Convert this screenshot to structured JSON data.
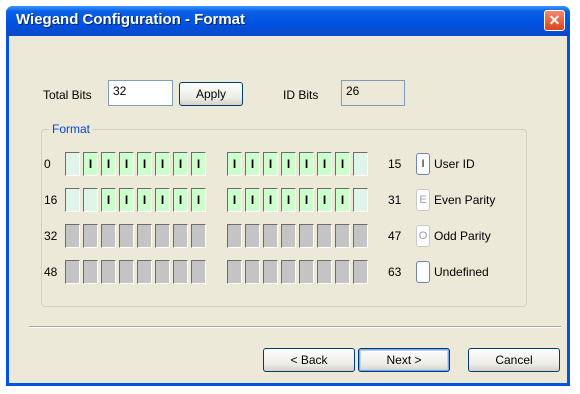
{
  "window": {
    "title": "Wiegand Configuration - Format",
    "close_glyph": "✕"
  },
  "total_bits": {
    "label": "Total Bits",
    "value": "32"
  },
  "apply_label": "Apply",
  "id_bits": {
    "label": "ID Bits",
    "value": "26"
  },
  "format": {
    "legend": "Format",
    "rows": [
      {
        "start": "0",
        "end": "15",
        "bits": [
          "N",
          "U",
          "U",
          "U",
          "U",
          "U",
          "U",
          "U",
          "U",
          "U",
          "U",
          "U",
          "U",
          "U",
          "U",
          "N"
        ],
        "marks": [
          "",
          "I",
          "I",
          "I",
          "I",
          "I",
          "I",
          "I",
          "I",
          "I",
          "I",
          "I",
          "I",
          "I",
          "I",
          ""
        ]
      },
      {
        "start": "16",
        "end": "31",
        "bits": [
          "N",
          "N",
          "U",
          "U",
          "U",
          "U",
          "U",
          "U",
          "U",
          "U",
          "U",
          "U",
          "U",
          "U",
          "U",
          "N"
        ],
        "marks": [
          "",
          "",
          "I",
          "I",
          "I",
          "I",
          "I",
          "I",
          "I",
          "I",
          "I",
          "I",
          "I",
          "I",
          "I",
          ""
        ]
      },
      {
        "start": "32",
        "end": "47",
        "bits": [
          "X",
          "X",
          "X",
          "X",
          "X",
          "X",
          "X",
          "X",
          "X",
          "X",
          "X",
          "X",
          "X",
          "X",
          "X",
          "X"
        ],
        "marks": [
          "",
          "",
          "",
          "",
          "",
          "",
          "",
          "",
          "",
          "",
          "",
          "",
          "",
          "",
          "",
          ""
        ]
      },
      {
        "start": "48",
        "end": "63",
        "bits": [
          "X",
          "X",
          "X",
          "X",
          "X",
          "X",
          "X",
          "X",
          "X",
          "X",
          "X",
          "X",
          "X",
          "X",
          "X",
          "X"
        ],
        "marks": [
          "",
          "",
          "",
          "",
          "",
          "",
          "",
          "",
          "",
          "",
          "",
          "",
          "",
          "",
          "",
          ""
        ]
      }
    ],
    "legend_items": [
      {
        "symbol": "I",
        "label": "User ID"
      },
      {
        "symbol": "E",
        "label": "Even Parity"
      },
      {
        "symbol": "O",
        "label": "Odd Parity"
      },
      {
        "symbol": "",
        "label": "Undefined"
      }
    ]
  },
  "buttons": {
    "back": "< Back",
    "next": "Next >",
    "cancel": "Cancel"
  },
  "colors": {
    "user_id_bit": "#ccffcc",
    "unused_bit": "#c4c4c4",
    "accent": "#0054e3"
  }
}
